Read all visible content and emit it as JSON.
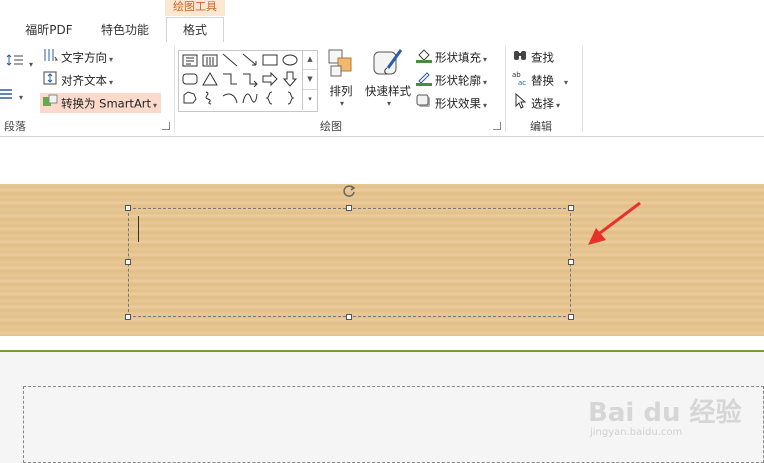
{
  "tabs": {
    "contextual_header": "绘图工具",
    "items": [
      "福昕PDF",
      "特色功能",
      "格式"
    ]
  },
  "ribbon": {
    "paragraph": {
      "text_direction": "文字方向",
      "align_text": "对齐文本",
      "convert_smartart": "转换为 SmartArt",
      "label": "段落"
    },
    "drawing": {
      "arrange": "排列",
      "quick_styles": "快速样式",
      "shape_fill": "形状填充",
      "shape_outline": "形状轮廓",
      "shape_effects": "形状效果",
      "label": "绘图"
    },
    "editing": {
      "find": "查找",
      "replace": "替换",
      "select": "选择",
      "label": "编辑"
    }
  },
  "watermark": {
    "brand": "Bai du 经验",
    "url": "jingyan.baidu.com"
  },
  "colors": {
    "accent_orange": "#c9672a",
    "arrow_red": "#e8312a",
    "divider_green": "#7a9a3a"
  }
}
